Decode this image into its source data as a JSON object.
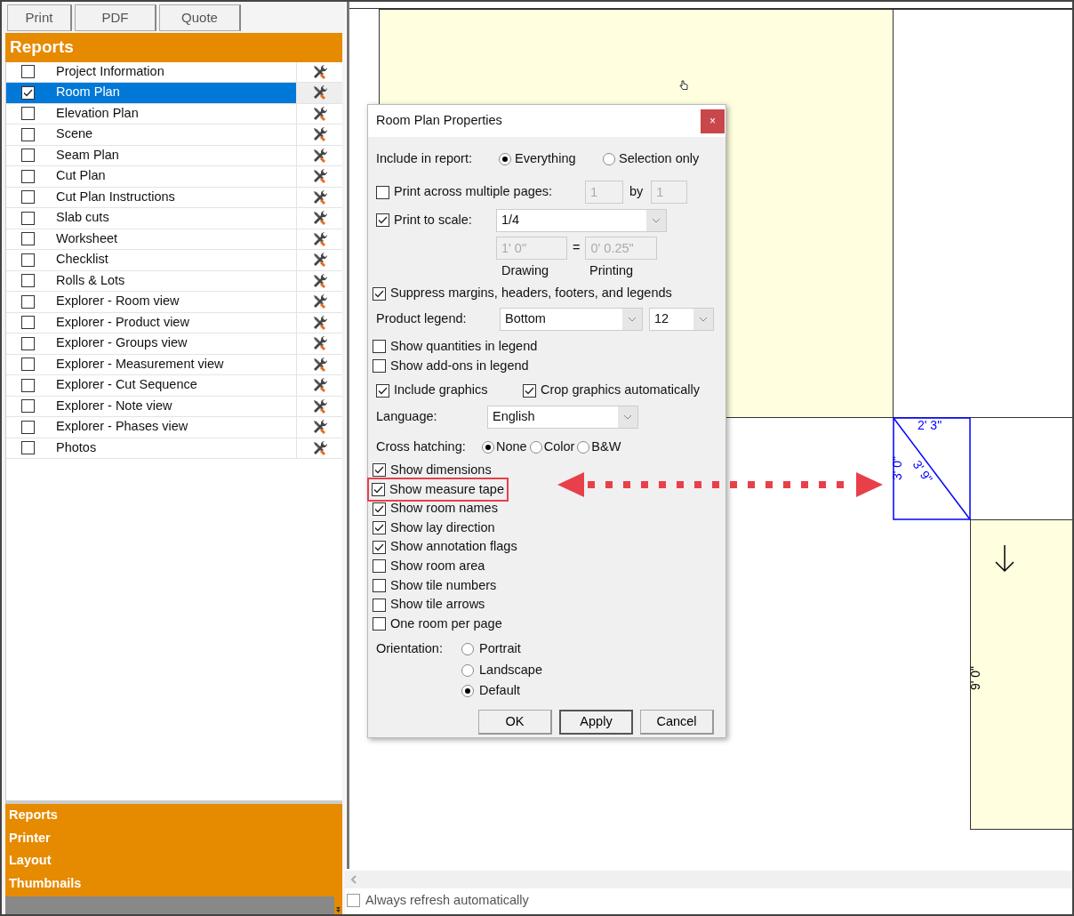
{
  "toolbar": {
    "buttons": [
      "Print",
      "PDF",
      "Quote"
    ]
  },
  "reports_panel": {
    "title": "Reports",
    "items": [
      {
        "label": "Project Information",
        "checked": false,
        "selected": false
      },
      {
        "label": "Room Plan",
        "checked": true,
        "selected": true
      },
      {
        "label": "Elevation Plan",
        "checked": false,
        "selected": false
      },
      {
        "label": "Scene",
        "checked": false,
        "selected": false
      },
      {
        "label": "Seam Plan",
        "checked": false,
        "selected": false
      },
      {
        "label": "Cut Plan",
        "checked": false,
        "selected": false
      },
      {
        "label": "Cut Plan Instructions",
        "checked": false,
        "selected": false
      },
      {
        "label": "Slab cuts",
        "checked": false,
        "selected": false
      },
      {
        "label": "Worksheet",
        "checked": false,
        "selected": false
      },
      {
        "label": "Checklist",
        "checked": false,
        "selected": false
      },
      {
        "label": "Rolls & Lots",
        "checked": false,
        "selected": false
      },
      {
        "label": "Explorer - Room view",
        "checked": false,
        "selected": false
      },
      {
        "label": "Explorer - Product view",
        "checked": false,
        "selected": false
      },
      {
        "label": "Explorer - Groups view",
        "checked": false,
        "selected": false
      },
      {
        "label": "Explorer - Measurement view",
        "checked": false,
        "selected": false
      },
      {
        "label": "Explorer - Cut Sequence",
        "checked": false,
        "selected": false
      },
      {
        "label": "Explorer - Note view",
        "checked": false,
        "selected": false
      },
      {
        "label": "Explorer - Phases view",
        "checked": false,
        "selected": false
      },
      {
        "label": "Photos",
        "checked": false,
        "selected": false
      }
    ]
  },
  "nav_sections": [
    "Reports",
    "Printer",
    "Layout",
    "Thumbnails"
  ],
  "dialog": {
    "title": "Room Plan Properties",
    "close": "×",
    "include": {
      "label": "Include in report:",
      "options": [
        {
          "label": "Everything",
          "selected": true
        },
        {
          "label": "Selection only",
          "selected": false
        }
      ]
    },
    "multiple_pages": {
      "label": "Print across multiple pages:",
      "checked": false,
      "across": "1",
      "by": "by",
      "down": "1"
    },
    "scale": {
      "label": "Print to scale:",
      "checked": true,
      "value": "1/4",
      "drawing": "1' 0\"",
      "equals": "=",
      "printing": "0' 0.25\"",
      "drawing_caption": "Drawing",
      "printing_caption": "Printing"
    },
    "suppress": {
      "label": "Suppress margins, headers, footers, and legends",
      "checked": true
    },
    "product_legend": {
      "label": "Product legend:",
      "position": "Bottom",
      "size": "12"
    },
    "legend_options": [
      {
        "label": "Show quantities in legend",
        "checked": false
      },
      {
        "label": "Show add-ons in legend",
        "checked": false
      }
    ],
    "graphics_options": [
      {
        "label": "Include graphics",
        "checked": true
      },
      {
        "label": "Crop graphics automatically",
        "checked": true
      }
    ],
    "language": {
      "label": "Language:",
      "value": "English"
    },
    "cross_hatching": {
      "label": "Cross hatching:",
      "options": [
        {
          "label": "None",
          "selected": true
        },
        {
          "label": "Color",
          "selected": false
        },
        {
          "label": "B&W",
          "selected": false
        }
      ]
    },
    "show_options": [
      {
        "label": "Show dimensions",
        "checked": true,
        "highlighted": false
      },
      {
        "label": "Show measure tape",
        "checked": true,
        "highlighted": true
      },
      {
        "label": "Show room names",
        "checked": true,
        "highlighted": false
      },
      {
        "label": "Show lay direction",
        "checked": true,
        "highlighted": false
      },
      {
        "label": "Show annotation flags",
        "checked": true,
        "highlighted": false
      },
      {
        "label": "Show room area",
        "checked": false,
        "highlighted": false
      },
      {
        "label": "Show tile numbers",
        "checked": false,
        "highlighted": false
      },
      {
        "label": "Show tile arrows",
        "checked": false,
        "highlighted": false
      },
      {
        "label": "One room per page",
        "checked": false,
        "highlighted": false
      }
    ],
    "orientation": {
      "label": "Orientation:",
      "options": [
        {
          "label": "Portrait",
          "selected": false
        },
        {
          "label": "Landscape",
          "selected": false
        },
        {
          "label": "Default",
          "selected": true
        }
      ]
    },
    "buttons": [
      {
        "label": "OK",
        "default": false
      },
      {
        "label": "Apply",
        "default": true
      },
      {
        "label": "Cancel",
        "default": false
      }
    ]
  },
  "drawing": {
    "top_width": "2' 3\"",
    "side_height": "3' 0\"",
    "diagonal": "3' 9\"",
    "room_length": "9' 0\""
  },
  "always_refresh": {
    "label": "Always refresh automatically",
    "checked": false
  }
}
